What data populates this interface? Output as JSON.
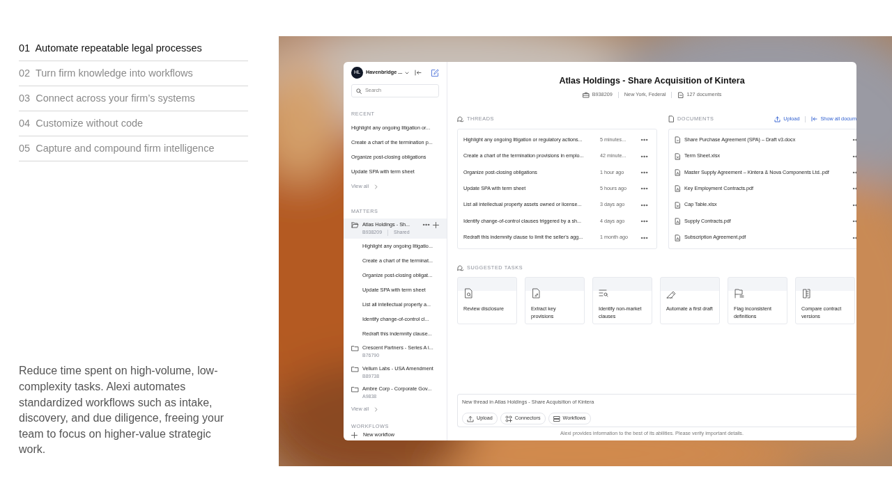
{
  "features": [
    {
      "number": "01",
      "label": "Automate repeatable legal processes",
      "selected": true
    },
    {
      "number": "02",
      "label": "Turn firm knowledge into workflows",
      "selected": false
    },
    {
      "number": "03",
      "label": "Connect across your firm’s systems",
      "selected": false
    },
    {
      "number": "04",
      "label": "Customize without code",
      "selected": false
    },
    {
      "number": "05",
      "label": "Capture and compound firm intelligence",
      "selected": false
    }
  ],
  "description": "Reduce time spent on high-volume, low-complexity tasks. Alexi automates standardized workflows such as intake, discovery, and due diligence, freeing your team to focus on higher-value strategic work.",
  "app": {
    "workspace": {
      "initials": "HL",
      "name": "Havenbridge ..."
    },
    "search": {
      "placeholder": "Search"
    },
    "recent": {
      "heading": "RECENT",
      "items": [
        "Highlight any ongoing litigation or...",
        "Create a chart of the termination p...",
        "Organize post-closing obligations",
        "Update SPA with term sheet"
      ],
      "view_all": "View all"
    },
    "matters": {
      "heading": "MATTERS",
      "items": [
        {
          "title": "Atlas Holdings - Sh...",
          "code": "B938209",
          "shared": "Shared",
          "selected": true,
          "expanded": true,
          "children": [
            "Highlight any ongoing litigatio...",
            "Create a chart of the terminat...",
            "Organize post-closing obligat...",
            "Update SPA with term sheet",
            "List all intellectual property a...",
            "Identify change-of-control cl...",
            "Redraft this indemnity clause..."
          ]
        },
        {
          "title": "Crescent Partners - Series A i...",
          "code": "B76790",
          "selected": false,
          "expanded": false
        },
        {
          "title": "Vellum Labs - USA Amendment",
          "code": "B89738",
          "selected": false,
          "expanded": false
        },
        {
          "title": "Ambre Corp - Corporate Gov...",
          "code": "A9838",
          "selected": false,
          "expanded": false
        }
      ],
      "view_all": "View all"
    },
    "workflows": {
      "heading": "WORKFLOWS",
      "new_label": "New workflow"
    },
    "header": {
      "title": "Atlas Holdings - Share Acquisition of Kintera",
      "code": "B938209",
      "location": "New York, Federal",
      "documents": "127 documents"
    },
    "threads": {
      "heading": "THREADS",
      "items": [
        {
          "title": "Highlight any ongoing litigation or regulatory actions...",
          "time": "5 minutes..."
        },
        {
          "title": "Create a chart of the termination provisions in emplo...",
          "time": "42 minute..."
        },
        {
          "title": "Organize post-closing obligations",
          "time": "1 hour ago"
        },
        {
          "title": "Update SPA with term sheet",
          "time": "5 hours ago"
        },
        {
          "title": "List all intellectual property assets owned or license...",
          "time": "3 days ago"
        },
        {
          "title": "Identify change-of-control clauses triggered by a sh...",
          "time": "4 days ago"
        },
        {
          "title": "Redraft this indemnity clause to limit the seller's agg...",
          "time": "1 month ago"
        }
      ]
    },
    "documents": {
      "heading": "DOCUMENTS",
      "upload": "Upload",
      "show_all": "Show all docum",
      "items": [
        {
          "name": "Share Purchase Agreement (SPA) – Draft v3.docx",
          "kind": "docx"
        },
        {
          "name": "Term Sheet.xlsx",
          "kind": "xlsx"
        },
        {
          "name": "Master Supply Agreement – Kintera & Nova Components Ltd..pdf",
          "kind": "pdf"
        },
        {
          "name": "Key Employment Contracts.pdf",
          "kind": "pdf"
        },
        {
          "name": "Cap Table.xlsx",
          "kind": "xlsx"
        },
        {
          "name": "Supply Contracts.pdf",
          "kind": "pdf"
        },
        {
          "name": "Subscription Agreement.pdf",
          "kind": "pdf"
        }
      ]
    },
    "suggested": {
      "heading": "SUGGESTED TASKS",
      "tasks": [
        {
          "label": "Review disclosure",
          "kind": "review"
        },
        {
          "label": "Extract key provisions",
          "kind": "extract"
        },
        {
          "label": "Identify non-market clauses",
          "kind": "identify"
        },
        {
          "label": "Automate a first draft",
          "kind": "draft"
        },
        {
          "label": "Flag inconsistent definitions",
          "kind": "flag"
        },
        {
          "label": "Compare contract versions",
          "kind": "compare"
        }
      ]
    },
    "composer": {
      "placeholder": "New thread in Atlas Holdings - Share Acquisition of Kintera",
      "buttons": [
        {
          "label": "Upload",
          "kind": "upload"
        },
        {
          "label": "Connectors",
          "kind": "connectors"
        },
        {
          "label": "Workflows",
          "kind": "workflows"
        }
      ]
    },
    "disclaimer": "Alexi provides information to the best of its abilities. Please verify important details."
  }
}
